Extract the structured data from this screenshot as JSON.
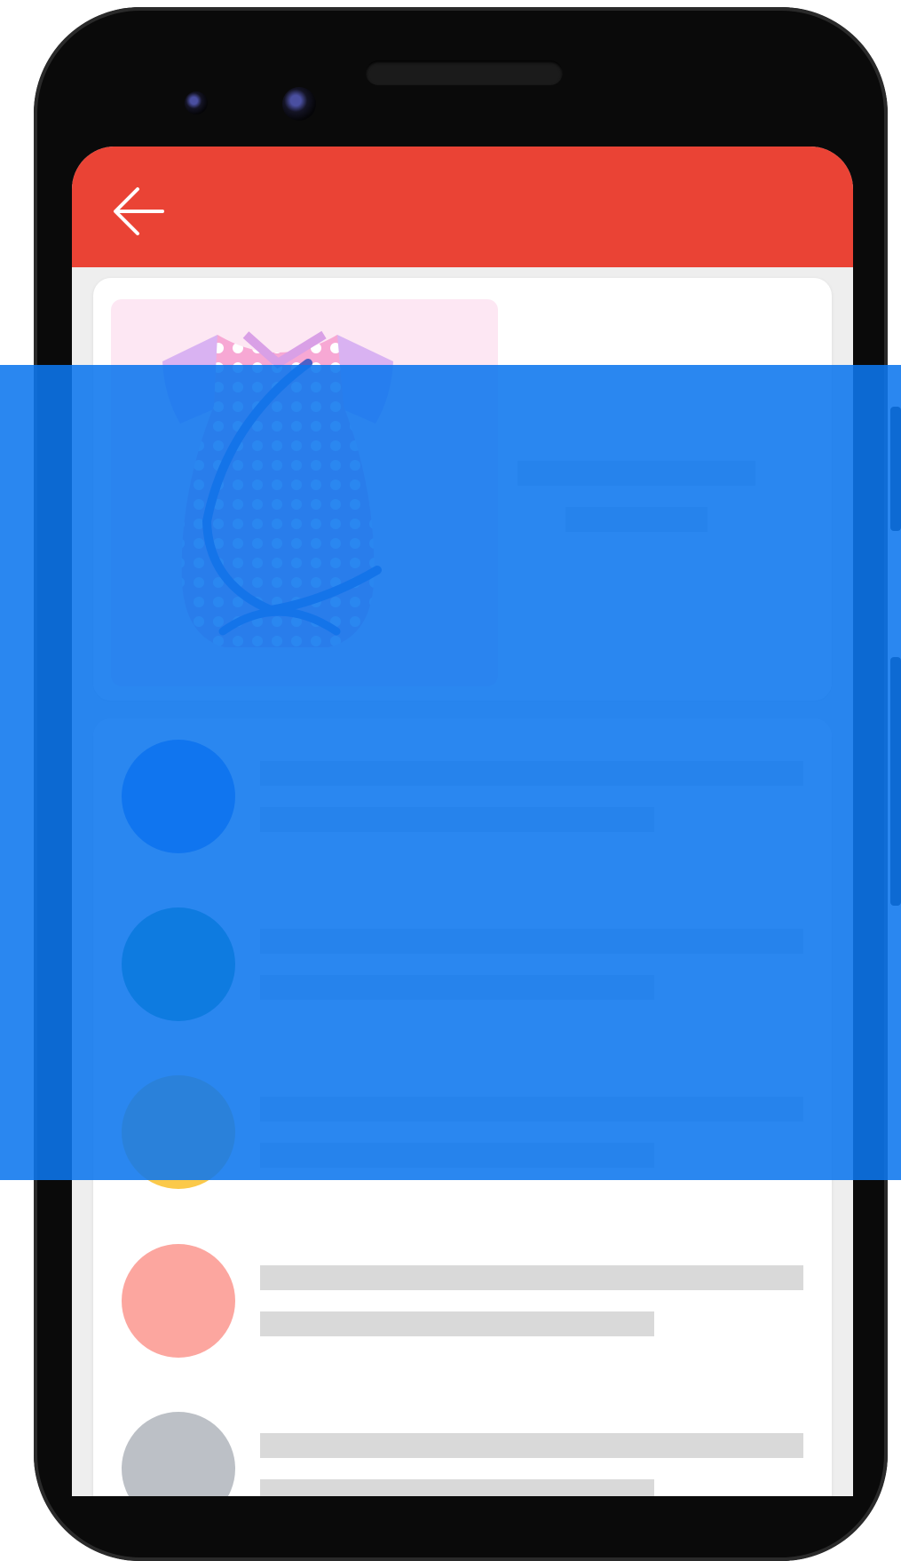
{
  "colors": {
    "app_bar": "#ea4335",
    "overlay": "#0d76ee",
    "placeholder": "#d9d9d9",
    "product_background": "#fde7f3",
    "avatar_colors": [
      "#2f6ff2",
      "#1a9a7a",
      "#fbc94a",
      "#fca69f",
      "#bcc0c6"
    ]
  },
  "app_bar": {
    "back_icon": "arrow-left-icon"
  },
  "product": {
    "image_icon": "baby-onesie-icon"
  },
  "list": {
    "rows": [
      {
        "avatar_color": "#2f6ff2"
      },
      {
        "avatar_color": "#1a9a7a"
      },
      {
        "avatar_color": "#fbc94a"
      },
      {
        "avatar_color": "#fca69f"
      },
      {
        "avatar_color": "#bcc0c6"
      }
    ]
  }
}
